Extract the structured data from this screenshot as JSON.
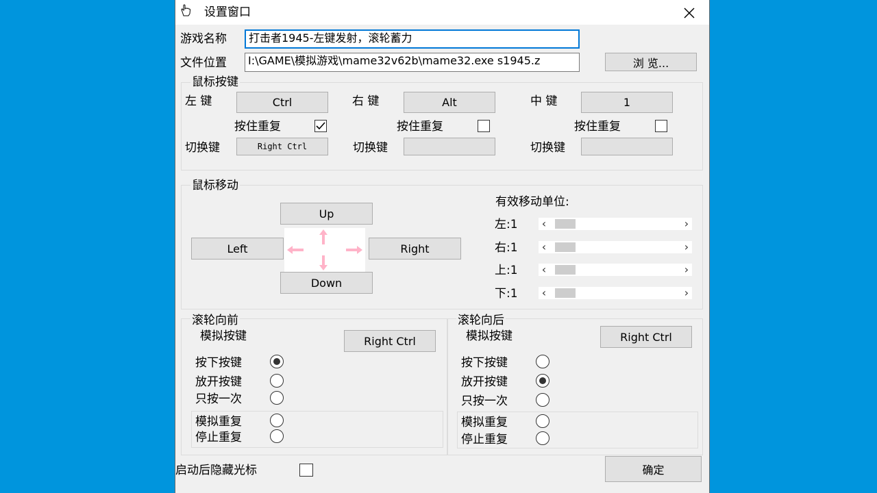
{
  "window": {
    "title": "设置窗口"
  },
  "game": {
    "name_label": "游戏名称",
    "name_value": "打击者1945-左键发射，滚轮蓄力",
    "path_label": "文件位置",
    "path_value": "I:\\GAME\\模拟游戏\\mame32v62b\\mame32.exe s1945.z",
    "browse_label": "浏 览..."
  },
  "mouse_keys": {
    "legend": "鼠标按键",
    "left": {
      "label": "左 键",
      "key": "Ctrl",
      "hold_label": "按住重复",
      "checked": true,
      "switch_label": "切换键",
      "switch_value": "Right Ctrl"
    },
    "right": {
      "label": "右 键",
      "key": "Alt",
      "hold_label": "按住重复",
      "checked": false,
      "switch_label": "切换键",
      "switch_value": ""
    },
    "middle": {
      "label": "中 键",
      "key": "1",
      "hold_label": "按住重复",
      "checked": false,
      "switch_label": "切换键",
      "switch_value": ""
    }
  },
  "mouse_move": {
    "legend": "鼠标移动",
    "up": "Up",
    "down": "Down",
    "left": "Left",
    "right": "Right",
    "unit_title": "有效移动单位:",
    "units": [
      {
        "label": "左:1",
        "value": 1
      },
      {
        "label": "右:1",
        "value": 1
      },
      {
        "label": "上:1",
        "value": 1
      },
      {
        "label": "下:1",
        "value": 1
      }
    ]
  },
  "wheel_forward": {
    "legend": "滚轮向前",
    "sim_label": "模拟按键",
    "sim_key": "Right Ctrl",
    "press": "按下按键",
    "release": "放开按键",
    "once": "只按一次",
    "repeat": "模拟重复",
    "stop": "停止重复",
    "selected": "press"
  },
  "wheel_back": {
    "legend": "滚轮向后",
    "sim_label": "模拟按键",
    "sim_key": "Right Ctrl",
    "press": "按下按键",
    "release": "放开按键",
    "once": "只按一次",
    "repeat": "模拟重复",
    "stop": "停止重复",
    "selected": "release"
  },
  "footer": {
    "hide_cursor_label": "启动后隐藏光标",
    "hide_cursor_checked": false,
    "ok_label": "确定"
  },
  "colors": {
    "desktop": "#0095dd",
    "arrow": "#ffb3c8",
    "focus": "#0078d7"
  }
}
